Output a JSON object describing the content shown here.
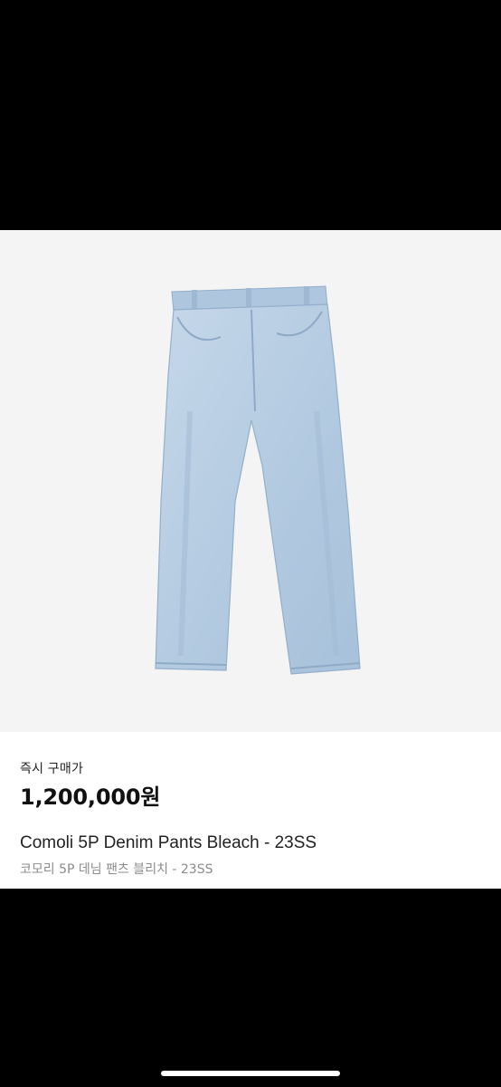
{
  "product": {
    "image_alt": "jeans-image",
    "price_label": "즉시 구매가",
    "price": "1,200,000원",
    "title_en": "Comoli 5P Denim Pants Bleach - 23SS",
    "title_ko": "코모리 5P 데님 팬츠 블리치 - 23SS"
  },
  "colors": {
    "image_background": "#f4f4f4",
    "denim": "#b9cfe3",
    "denim_shadow": "#9db8d2",
    "panel": "#ffffff"
  }
}
